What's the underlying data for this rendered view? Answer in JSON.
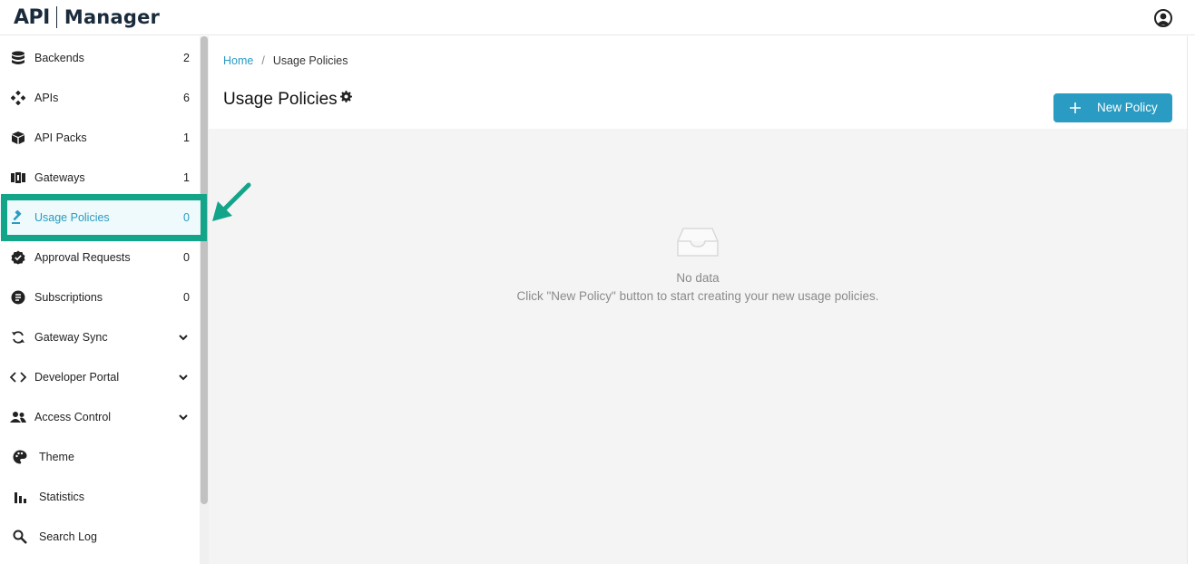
{
  "header": {
    "logo_api": "API",
    "logo_manager": "Manager"
  },
  "sidebar": {
    "items": [
      {
        "label": "Backends",
        "count": "2",
        "icon": "database-icon"
      },
      {
        "label": "APIs",
        "count": "6",
        "icon": "api-nodes-icon"
      },
      {
        "label": "API Packs",
        "count": "1",
        "icon": "package-icon"
      },
      {
        "label": "Gateways",
        "count": "1",
        "icon": "gateway-icon"
      },
      {
        "label": "Usage Policies",
        "count": "0",
        "icon": "gavel-icon",
        "active": true
      },
      {
        "label": "Approval Requests",
        "count": "0",
        "icon": "verified-badge-icon"
      },
      {
        "label": "Subscriptions",
        "count": "0",
        "icon": "subscription-icon"
      },
      {
        "label": "Gateway Sync",
        "icon": "sync-icon"
      },
      {
        "label": "Developer Portal",
        "icon": "code-brackets-icon"
      },
      {
        "label": "Access Control",
        "icon": "users-icon"
      },
      {
        "label": "Theme",
        "icon": "palette-icon"
      },
      {
        "label": "Statistics",
        "icon": "bar-chart-icon"
      },
      {
        "label": "Search Log",
        "icon": "search-icon"
      }
    ]
  },
  "breadcrumb": {
    "home": "Home",
    "separator": "/",
    "current": "Usage Policies"
  },
  "page": {
    "title": "Usage Policies",
    "new_button": "New Policy"
  },
  "empty_state": {
    "title": "No data",
    "description": "Click \"New Policy\" button to start creating your new usage policies."
  },
  "colors": {
    "accent": "#2a9bc2",
    "highlight": "#13a58a",
    "active_bg": "#eefafb"
  }
}
